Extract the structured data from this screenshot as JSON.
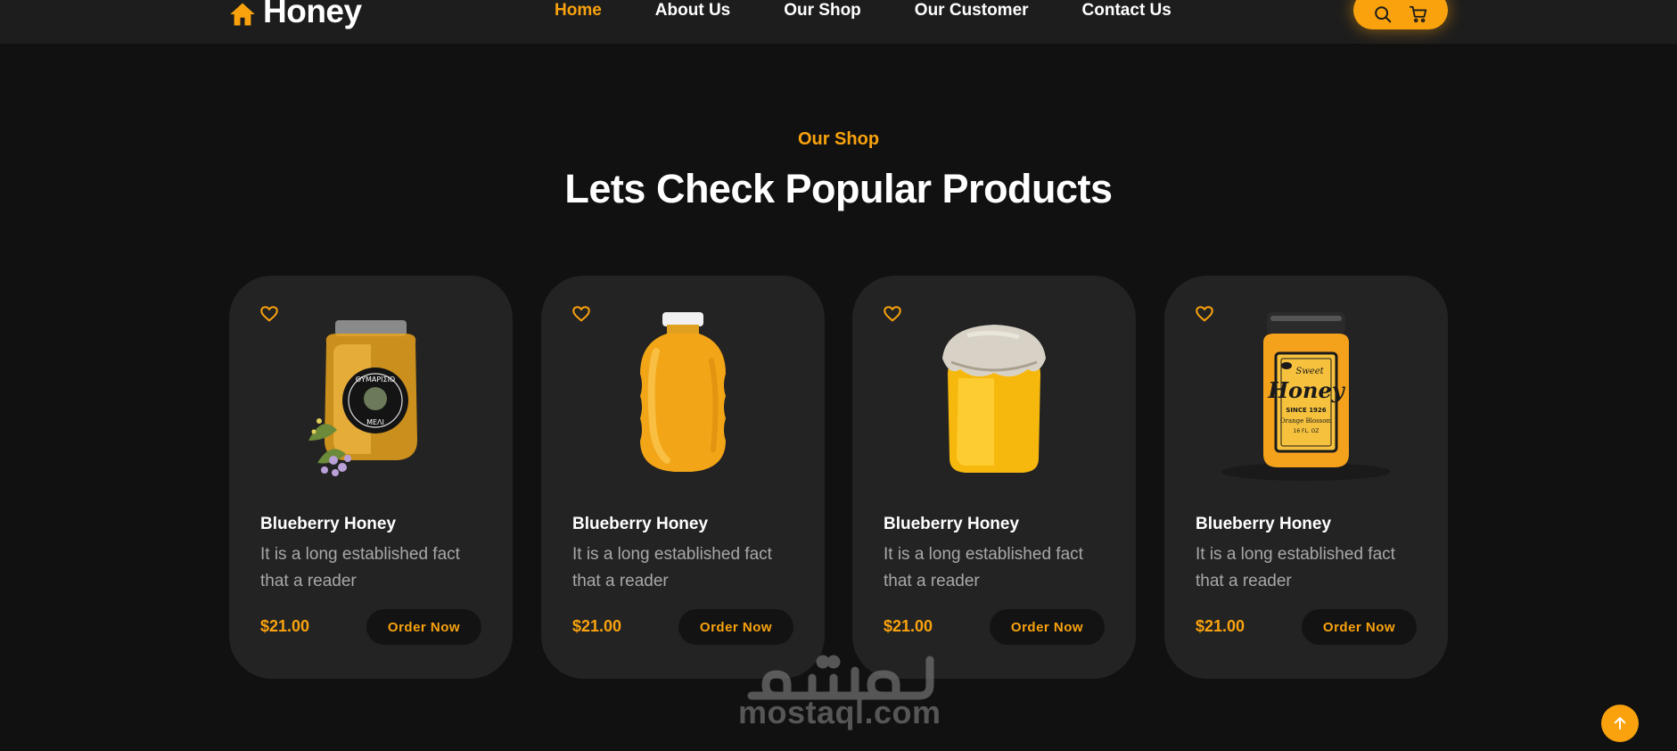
{
  "brand": {
    "name": "Honey",
    "icon": "home-icon"
  },
  "nav": {
    "items": [
      {
        "label": "Home",
        "active": true
      },
      {
        "label": "About Us",
        "active": false
      },
      {
        "label": "Our Shop",
        "active": false
      },
      {
        "label": "Our Customer",
        "active": false
      },
      {
        "label": "Contact Us",
        "active": false
      }
    ]
  },
  "header_actions": {
    "icons": [
      "search-icon",
      "cart-icon"
    ]
  },
  "section": {
    "kicker": "Our Shop",
    "title": "Lets Check Popular Products"
  },
  "products": [
    {
      "name": "Blueberry Honey",
      "description": "It is a long established fact that a reader",
      "price": "$21.00",
      "button": "Order Now",
      "image": "round-jar-with-label-and-flowers"
    },
    {
      "name": "Blueberry Honey",
      "description": "It is a long established fact that a reader",
      "price": "$21.00",
      "button": "Order Now",
      "image": "squeeze-bottle"
    },
    {
      "name": "Blueberry Honey",
      "description": "It is a long established fact that a reader",
      "price": "$21.00",
      "button": "Order Now",
      "image": "jar-with-cloth-cover"
    },
    {
      "name": "Blueberry Honey",
      "description": "It is a long established fact that a reader",
      "price": "$21.00",
      "button": "Order Now",
      "image": "jar-with-honey-label"
    }
  ],
  "jar4_label": {
    "top": "Sweet",
    "main": "Honey",
    "since": "SINCE 1926",
    "sub": "Orange Blossom",
    "size": "16 FL. OZ"
  },
  "jar1_label": {
    "top": "ΘΥΜΑΡΙΣΙΟ",
    "bottom": "ΜΕΛΙ"
  },
  "watermark": {
    "text": "mostaql.com"
  },
  "colors": {
    "accent": "#f9a20e",
    "background": "#111111",
    "card": "#232323",
    "header": "#1d1d1d"
  }
}
